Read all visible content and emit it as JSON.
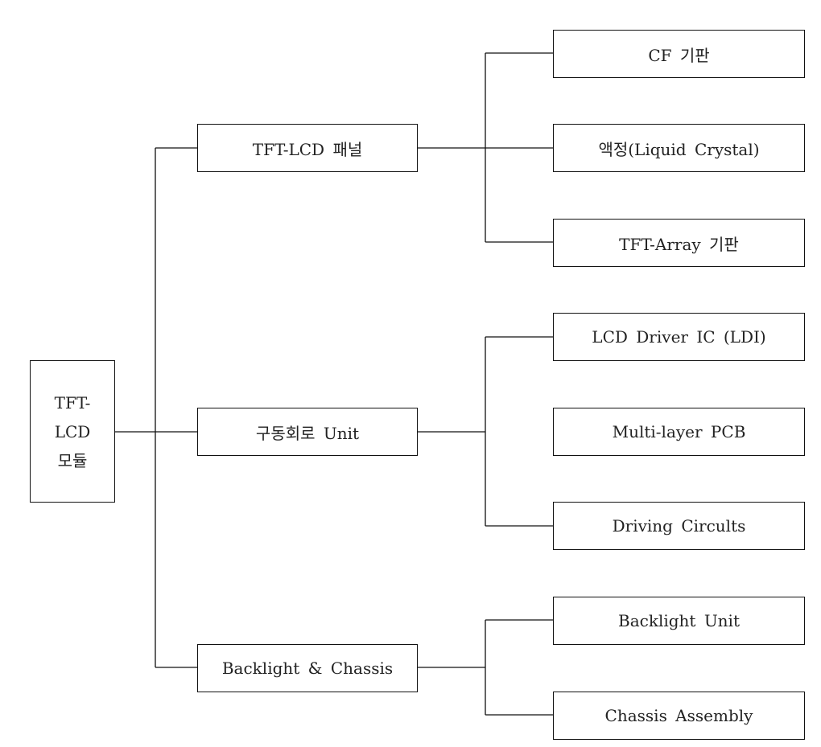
{
  "root": {
    "lines": [
      "TFT-",
      "LCD",
      "모듈"
    ]
  },
  "branches": [
    {
      "label": "TFT-LCD 패널",
      "children": [
        "CF 기판",
        "액정(Liquid Crystal)",
        "TFT-Array 기판"
      ]
    },
    {
      "label": "구동회로 Unit",
      "children": [
        "LCD Driver IC (LDI)",
        "Multi-layer PCB",
        "Driving Circults"
      ]
    },
    {
      "label": "Backlight & Chassis",
      "children": [
        "Backlight Unit",
        "Chassis Assembly"
      ]
    }
  ]
}
